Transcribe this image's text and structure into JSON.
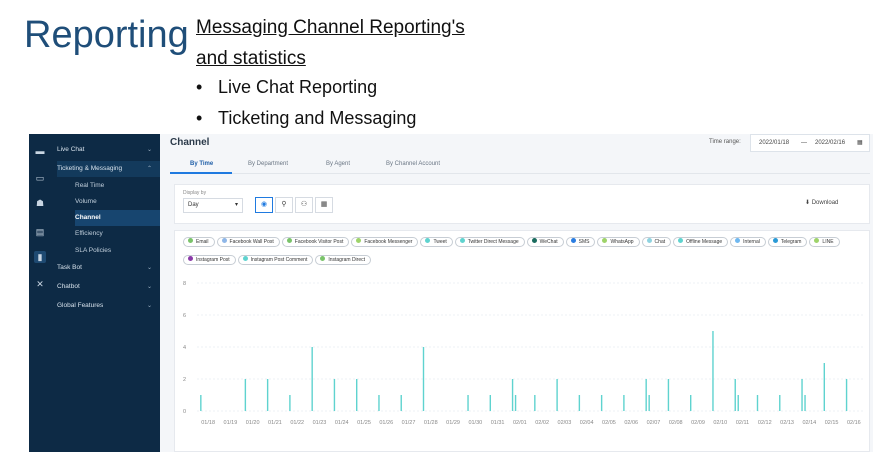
{
  "slide": {
    "title": "Reporting",
    "heading": "Messaging Channel Reporting's and statistics",
    "bullets": [
      "Live Chat Reporting",
      "Ticketing and Messaging"
    ]
  },
  "sidebar": {
    "items": [
      {
        "label": "Live Chat",
        "chevron": "⌄"
      },
      {
        "label": "Ticketing & Messaging",
        "chevron": "⌃"
      },
      {
        "label": "Real Time"
      },
      {
        "label": "Volume"
      },
      {
        "label": "Channel"
      },
      {
        "label": "Efficiency"
      },
      {
        "label": "SLA Policies"
      },
      {
        "label": "Task Bot",
        "chevron": "⌄"
      },
      {
        "label": "Chatbot",
        "chevron": "⌄"
      },
      {
        "label": "Global Features",
        "chevron": "⌄"
      }
    ]
  },
  "header": {
    "title": "Channel",
    "time_range_label": "Time range:",
    "start_date": "2022/01/18",
    "separator": "—",
    "end_date": "2022/02/16"
  },
  "tabs": [
    "By Time",
    "By Department",
    "By Agent",
    "By Channel Account"
  ],
  "filter": {
    "display_label": "Display by",
    "display_value": "Day",
    "download_label": "Download"
  },
  "colors": {
    "accent": "#1f7ae0",
    "bar": "#5fd3cf",
    "sidebar": "#0d2a45"
  },
  "legend": [
    {
      "name": "Email",
      "color": "#7ac36a"
    },
    {
      "name": "Facebook Wall Post",
      "color": "#8fb7e8"
    },
    {
      "name": "Facebook Visitor Post",
      "color": "#7ac36a"
    },
    {
      "name": "Facebook Messenger",
      "color": "#9ed36a"
    },
    {
      "name": "Tweet",
      "color": "#5fd3cf"
    },
    {
      "name": "Twitter Direct Message",
      "color": "#5fd3cf"
    },
    {
      "name": "WeChat",
      "color": "#1a6b5e"
    },
    {
      "name": "SMS",
      "color": "#2a7de1"
    },
    {
      "name": "WhatsApp",
      "color": "#9ed36a"
    },
    {
      "name": "Chat",
      "color": "#8fd3e0"
    },
    {
      "name": "Offline Message",
      "color": "#5fd3cf"
    },
    {
      "name": "Internal",
      "color": "#6fb8f0"
    },
    {
      "name": "Telegram",
      "color": "#2a9ad6"
    },
    {
      "name": "LINE",
      "color": "#9ed36a"
    },
    {
      "name": "Instagram Post",
      "color": "#8a3aa8"
    },
    {
      "name": "Instagram Post Comment",
      "color": "#5fd3cf"
    },
    {
      "name": "Instagram Direct",
      "color": "#7ac36a"
    }
  ],
  "chart_data": {
    "type": "bar",
    "y_ticks": [
      "8",
      "6",
      "4",
      "2",
      "0"
    ],
    "ylim": [
      0,
      8
    ],
    "categories": [
      "01/18",
      "01/19",
      "01/20",
      "01/21",
      "01/22",
      "01/23",
      "01/24",
      "01/25",
      "01/26",
      "01/27",
      "01/28",
      "01/29",
      "01/30",
      "01/31",
      "02/01",
      "02/02",
      "02/03",
      "02/04",
      "02/05",
      "02/06",
      "02/07",
      "02/08",
      "02/09",
      "02/10",
      "02/11",
      "02/12",
      "02/13",
      "02/14",
      "02/15",
      "02/16"
    ],
    "values": [
      [
        1
      ],
      [
        0
      ],
      [
        2
      ],
      [
        2
      ],
      [
        1
      ],
      [
        4
      ],
      [
        2
      ],
      [
        2
      ],
      [
        1
      ],
      [
        1
      ],
      [
        4
      ],
      [
        0
      ],
      [
        1
      ],
      [
        1
      ],
      [
        2,
        1
      ],
      [
        1
      ],
      [
        2
      ],
      [
        1
      ],
      [
        1
      ],
      [
        1
      ],
      [
        2,
        1
      ],
      [
        2
      ],
      [
        1
      ],
      [
        5
      ],
      [
        2,
        1
      ],
      [
        1
      ],
      [
        1
      ],
      [
        2,
        1
      ],
      [
        3
      ],
      [
        2
      ]
    ]
  }
}
